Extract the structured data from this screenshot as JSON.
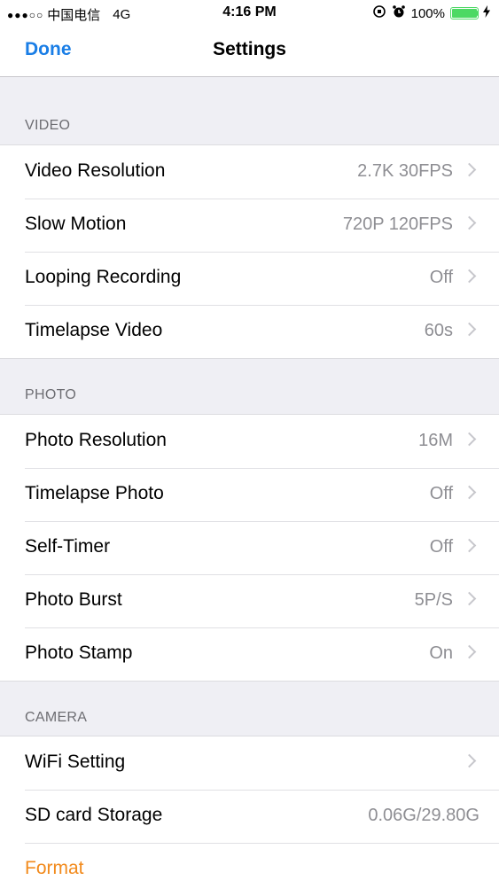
{
  "status_bar": {
    "carrier": "中国电信",
    "network": "4G",
    "time": "4:16 PM",
    "battery_percent": "100%",
    "battery_level": 1.0
  },
  "nav": {
    "done_label": "Done",
    "title": "Settings"
  },
  "sections": {
    "video": {
      "header": "VIDEO",
      "rows": [
        {
          "label": "Video Resolution",
          "value": "2.7K 30FPS"
        },
        {
          "label": "Slow Motion",
          "value": "720P 120FPS"
        },
        {
          "label": "Looping Recording",
          "value": "Off"
        },
        {
          "label": "Timelapse Video",
          "value": "60s"
        }
      ]
    },
    "photo": {
      "header": "PHOTO",
      "rows": [
        {
          "label": "Photo Resolution",
          "value": "16M"
        },
        {
          "label": "Timelapse Photo",
          "value": "Off"
        },
        {
          "label": "Self-Timer",
          "value": "Off"
        },
        {
          "label": "Photo Burst",
          "value": "5P/S"
        },
        {
          "label": "Photo Stamp",
          "value": "On"
        }
      ]
    },
    "camera": {
      "header": "CAMERA",
      "rows": [
        {
          "label": "WiFi Setting",
          "value": ""
        },
        {
          "label": "SD card Storage",
          "value": "0.06G/29.80G"
        },
        {
          "label": "Format",
          "value": ""
        }
      ]
    }
  },
  "colors": {
    "accent_blue": "#1a7ee6",
    "destructive_orange": "#f28a1c",
    "battery_green": "#4cd964"
  }
}
